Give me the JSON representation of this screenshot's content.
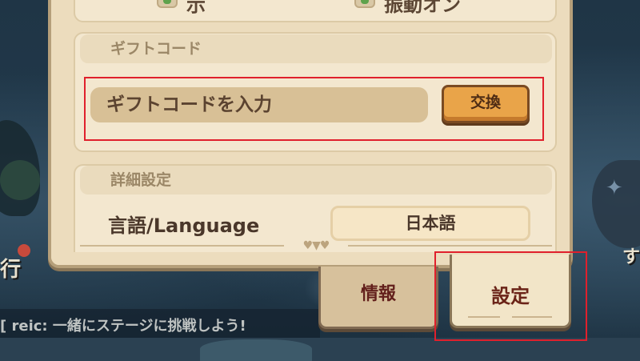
{
  "background": {
    "left_text": "行",
    "right_text": "す",
    "chat_message": "[ reic: 一緒にステージに挑戦しよう!"
  },
  "top_section": {
    "partial_left": "示",
    "partial_right": "振動オン"
  },
  "gift_code": {
    "section_title": "ギフトコード",
    "input_placeholder": "ギフトコードを入力",
    "redeem_label": "交換"
  },
  "advanced": {
    "section_title": "詳細設定",
    "language_label": "言語/Language",
    "language_value": "日本語"
  },
  "tabs": [
    {
      "label": "情報",
      "active": false
    },
    {
      "label": "設定",
      "active": true
    }
  ],
  "colors": {
    "panel": "#ecdcbd",
    "redeem_button": "#e9a449",
    "highlight": "#e0202c"
  }
}
